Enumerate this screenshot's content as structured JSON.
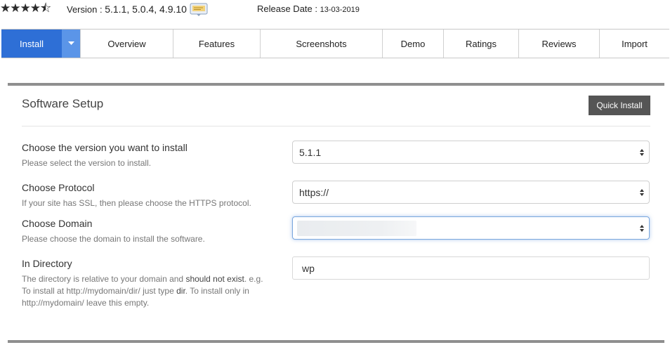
{
  "header": {
    "rating_stars": "★★★★⯪",
    "version_prefix": "Version : ",
    "version_value": "5.1.1, 5.0.4, 4.9.10",
    "release_prefix": "Release Date : ",
    "release_value": "13-03-2019"
  },
  "tabs": [
    "Install",
    "",
    "Overview",
    "Features",
    "Screenshots",
    "Demo",
    "Ratings",
    "Reviews",
    "Import"
  ],
  "panel": {
    "title": "Software Setup",
    "quick_install_label": "Quick Install"
  },
  "fields": {
    "version": {
      "label": "Choose the version you want to install",
      "help": "Please select the version to install.",
      "value": "5.1.1"
    },
    "protocol": {
      "label": "Choose Protocol",
      "help": "If your site has SSL, then please choose the HTTPS protocol.",
      "value": "https://"
    },
    "domain": {
      "label": "Choose Domain",
      "help": "Please choose the domain to install the software.",
      "value": ""
    },
    "directory": {
      "label": "In Directory",
      "help_1": "The directory is relative to your domain and ",
      "help_strong_1": "should not exist",
      "help_2": ". e.g. To install at http://mydomain/dir/ just type ",
      "help_strong_2": "dir",
      "help_3": ". To install only in http://mydomain/ leave this empty.",
      "value": "wp"
    }
  },
  "colors": {
    "active_tab": "#2e6fd6",
    "caret_tab": "#5b95e8",
    "quick_install_bg": "#555555"
  }
}
